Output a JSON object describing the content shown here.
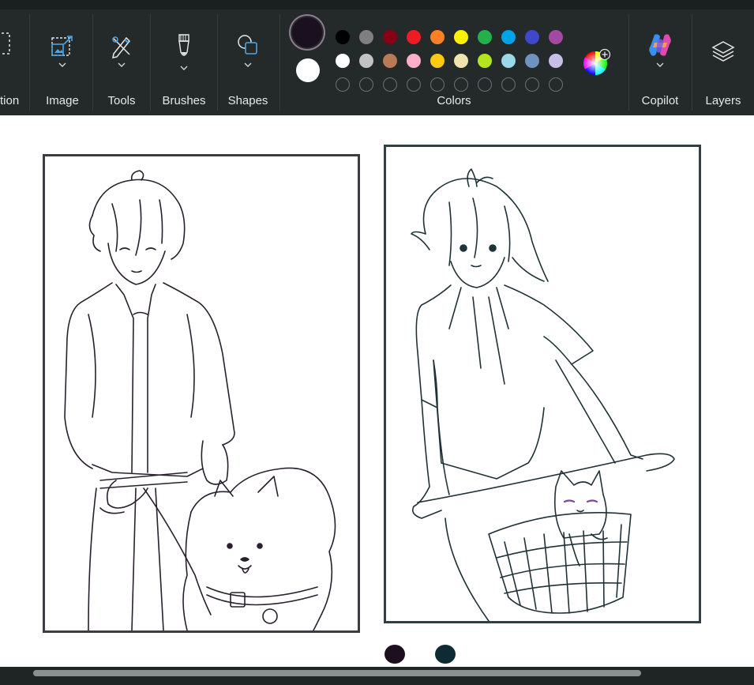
{
  "ribbon": {
    "groups": [
      {
        "label": "tion",
        "icon": "selection-icon"
      },
      {
        "label": "Image",
        "icon": "image-icon"
      },
      {
        "label": "Tools",
        "icon": "pencil-tools-icon"
      },
      {
        "label": "Brushes",
        "icon": "brush-icon"
      },
      {
        "label": "Shapes",
        "icon": "shapes-icon"
      },
      {
        "label": "Colors",
        "icon": "palette"
      },
      {
        "label": "Copilot",
        "icon": "copilot-icon"
      },
      {
        "label": "Layers",
        "icon": "layers-icon"
      }
    ]
  },
  "colors": {
    "primary": "#1a1020",
    "secondary": "#ffffff",
    "row1": [
      "#000000",
      "#7f7f7f",
      "#880015",
      "#ed1c24",
      "#ff7f27",
      "#fff200",
      "#22b14c",
      "#00a2e8",
      "#3f48cc",
      "#a349a4"
    ],
    "row2": [
      "#ffffff",
      "#c3c3c3",
      "#b97a57",
      "#ffaec9",
      "#ffc90e",
      "#efe4b0",
      "#b5e61d",
      "#99d9ea",
      "#7092be",
      "#c8bfe7"
    ],
    "row3_empty_count": 10
  },
  "canvas": {
    "drawing_left": "line-art-boy-with-dog",
    "drawing_right": "line-art-boy-on-bicycle-with-cat",
    "dot_colors": [
      "#1c0f1e",
      "#0f2a33"
    ]
  }
}
